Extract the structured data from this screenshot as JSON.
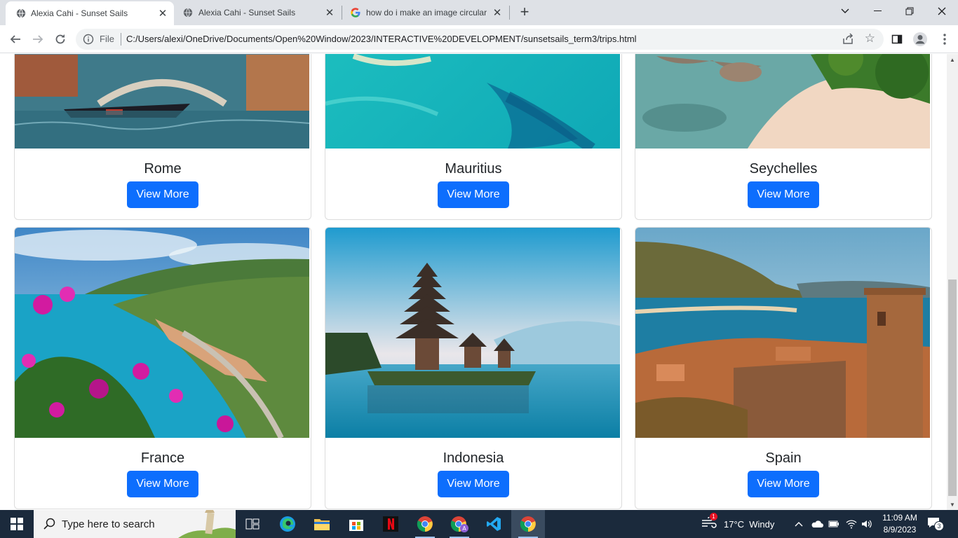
{
  "browser": {
    "tabs": [
      {
        "title": "Alexia Cahi - Sunset Sails",
        "active": true,
        "icon": "globe-icon"
      },
      {
        "title": "Alexia Cahi - Sunset Sails",
        "active": false,
        "icon": "globe-icon"
      },
      {
        "title": "how do i make an image circular",
        "active": false,
        "icon": "google-icon"
      }
    ],
    "new_tab_label": "+",
    "address": {
      "scheme_label": "File",
      "url": "C:/Users/alexi/OneDrive/Documents/Open%20Window/2023/INTERACTIVE%20DEVELOPMENT/sunsetsails_term3/trips.html"
    }
  },
  "page": {
    "destinations": [
      {
        "name": "Rome",
        "button": "View More",
        "scene": "venice-canal-gondola"
      },
      {
        "name": "Mauritius",
        "button": "View More",
        "scene": "turquoise-ocean"
      },
      {
        "name": "Seychelles",
        "button": "View More",
        "scene": "tropical-beach-rocks"
      },
      {
        "name": "France",
        "button": "View More",
        "scene": "riviera-coast-flowers"
      },
      {
        "name": "Indonesia",
        "button": "View More",
        "scene": "bali-temple-lake"
      },
      {
        "name": "Spain",
        "button": "View More",
        "scene": "spanish-castle-bay"
      }
    ],
    "accent_color": "#0d6efd"
  },
  "taskbar": {
    "search_placeholder": "Type here to search",
    "weather": "17°C  Windy",
    "weather_badge": "1",
    "time": "11:09 AM",
    "date": "8/9/2023",
    "notification_count": "3",
    "apps": [
      "task-view-icon",
      "edge-icon",
      "file-explorer-icon",
      "microsoft-store-icon",
      "netflix-icon",
      "chrome-icon",
      "chrome-profile-icon",
      "vscode-icon",
      "chrome-active-icon"
    ]
  }
}
